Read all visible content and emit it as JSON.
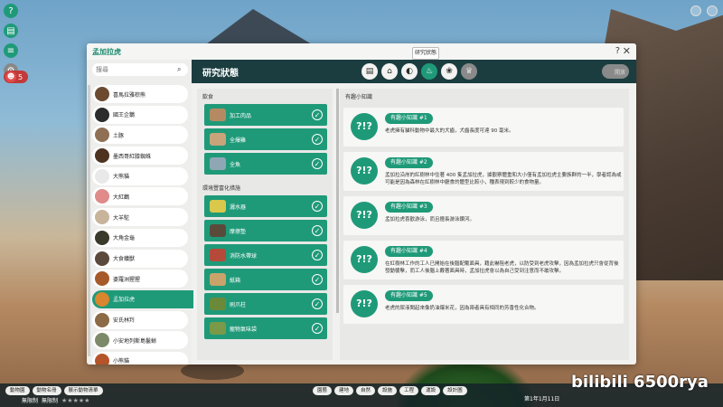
{
  "window": {
    "title": "孟加拉虎",
    "help": "?",
    "close": "✕",
    "tooltip": "研究狀態"
  },
  "search": {
    "placeholder": "搜尋"
  },
  "animals": [
    {
      "name": "喜馬拉雅棕熊",
      "color": "#6b4a30"
    },
    {
      "name": "國王企鵝",
      "color": "#2c2c2c"
    },
    {
      "name": "土豚",
      "color": "#8f7055"
    },
    {
      "name": "墨西哥紅膝蜘蛛",
      "color": "#4d3320"
    },
    {
      "name": "大熊貓",
      "color": "#e9e9e9"
    },
    {
      "name": "大紅鸛",
      "color": "#e08a8a"
    },
    {
      "name": "大羊駝",
      "color": "#c7b49b"
    },
    {
      "name": "大角金龜",
      "color": "#3a3a2a"
    },
    {
      "name": "大食蟻獸",
      "color": "#5b4a3b"
    },
    {
      "name": "婆羅洲猩猩",
      "color": "#a65a2a"
    },
    {
      "name": "孟加拉虎",
      "color": "#d9862e"
    },
    {
      "name": "安氏林羚",
      "color": "#8b6a45"
    },
    {
      "name": "小安地列斯島鬣蜥",
      "color": "#7d8a6a"
    },
    {
      "name": "小熊貓",
      "color": "#b5542a"
    },
    {
      "name": "巴西蛇頸龜",
      "color": "#5a5a40"
    }
  ],
  "header": {
    "title": "研究狀態",
    "tabs": [
      {
        "icon": "document-icon",
        "glyph": "▤"
      },
      {
        "icon": "habitat-icon",
        "glyph": "⌂"
      },
      {
        "icon": "food-icon",
        "glyph": "◐"
      },
      {
        "icon": "enrichment-icon",
        "glyph": "♨"
      },
      {
        "icon": "paw-icon",
        "glyph": "❀"
      },
      {
        "icon": "trophy-icon",
        "glyph": "♛"
      }
    ],
    "button": "開放"
  },
  "diet": {
    "title": "飲食",
    "items": [
      {
        "name": "加工肉品",
        "color": "#b58a62"
      },
      {
        "name": "全爆雞",
        "color": "#c9a37a"
      },
      {
        "name": "全魚",
        "color": "#8fa7b5"
      }
    ]
  },
  "enrichment": {
    "title": "環境豐富化措施",
    "items": [
      {
        "name": "灑水器",
        "color": "#d9c84a"
      },
      {
        "name": "摩擦墊",
        "color": "#5a4a3a"
      },
      {
        "name": "消防水帶球",
        "color": "#b54a3a"
      },
      {
        "name": "紙箱",
        "color": "#c9a36a"
      },
      {
        "name": "刷爪柱",
        "color": "#6a8a3a"
      },
      {
        "name": "寵物氣味袋",
        "color": "#7a9a4a"
      }
    ]
  },
  "facts": {
    "title": "有趣小知識",
    "items": [
      {
        "label": "有趣小知識 #1",
        "text": "老虎擁有貓科動物中最大的犬齒，犬齒長度可達 90 毫米。"
      },
      {
        "label": "有趣小知識 #2",
        "text": "孟加拉沿岸的紅樹林中住著 400 隻孟加拉虎，據觀察體重和大小僅有孟加拉虎主要族群的一半，學者認為或可能是因為森林在紅樹林中廳食的體型比較小，種表現到較少的食物量。"
      },
      {
        "label": "有趣小知識 #3",
        "text": "孟加拉虎喜歡游泳，而且擅長游泳鑽河。"
      },
      {
        "label": "有趣小知識 #4",
        "text": "在紅樹林工作的工人已開始在後腦配戴面具，藉此嚇阻老虎，以防受到老虎攻擊，因為孟加拉虎只會從背後發動襲擊，而工人後腦上戴著面具時，孟加拉虎會以為自己受到注意而不敢攻擊。"
      },
      {
        "label": "有趣小知識 #5",
        "text": "老虎的尿液聞起來像奶油爆米花，因為兩者具有相同的芳香性化合物。"
      }
    ]
  },
  "bottombar": {
    "left": [
      "動物園",
      "動物名冊",
      "展示動物清單"
    ],
    "limits": [
      "無限制",
      "無限制"
    ],
    "stars": "★★★★★",
    "center": [
      "園藝",
      "建地",
      "自然",
      "設施",
      "工程",
      "運設",
      "設計圖"
    ],
    "date": "第1年1月11日"
  },
  "watermark": "bilibili 6500rya",
  "hud": {
    "money": "5"
  }
}
